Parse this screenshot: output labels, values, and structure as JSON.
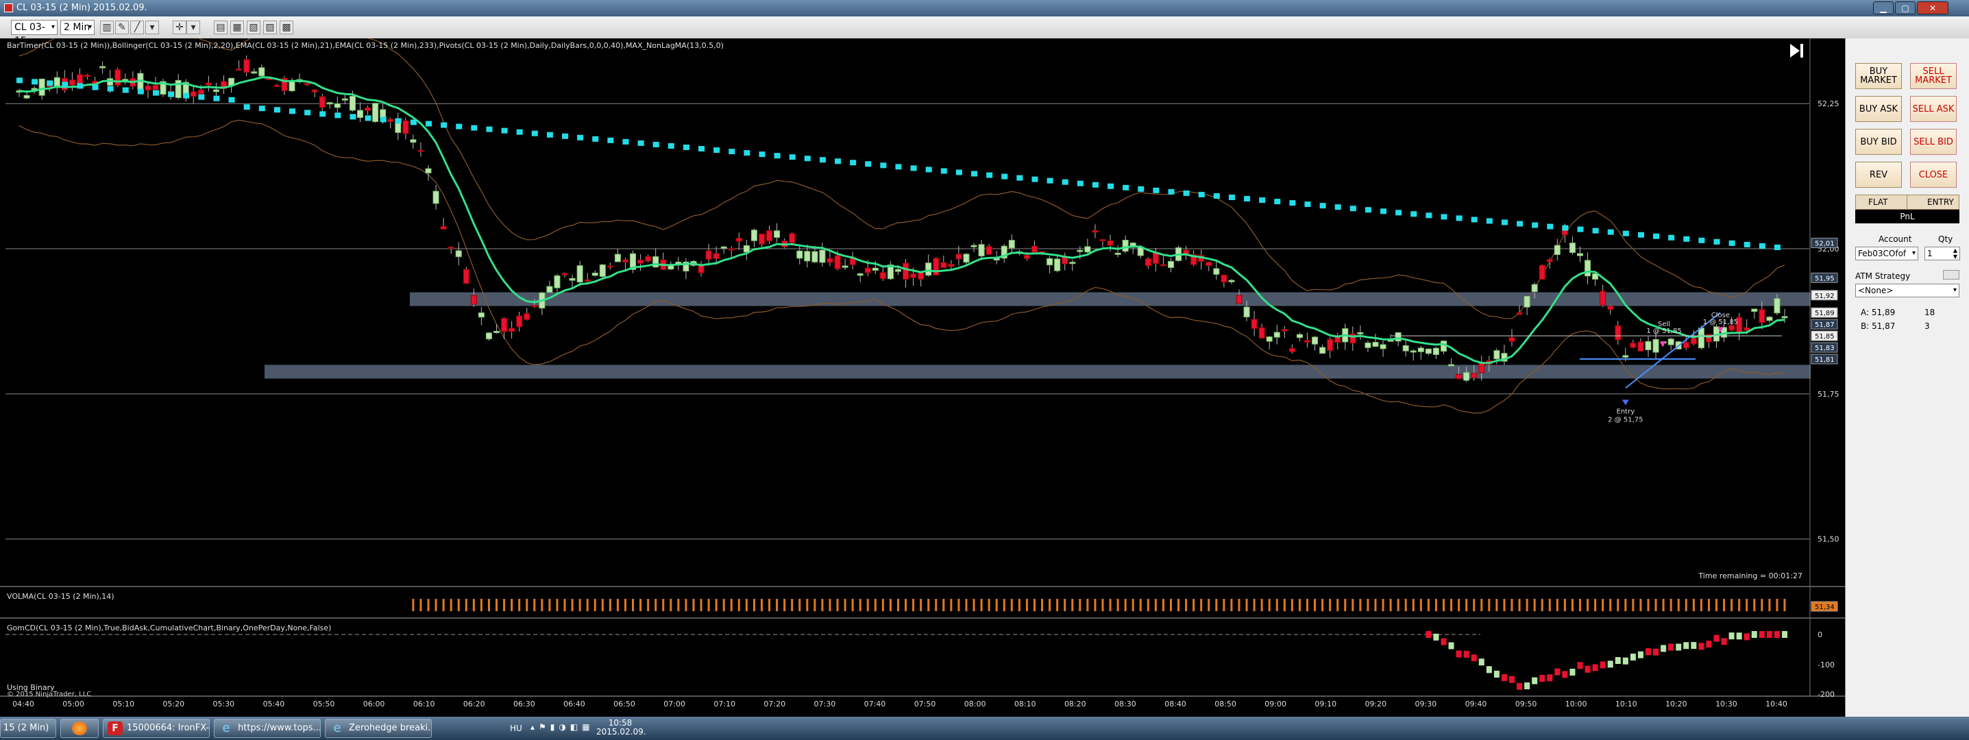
{
  "window": {
    "title": "CL 03-15 (2 Min)  2015.02.09."
  },
  "toolbar": {
    "instrument": "CL 03-15",
    "interval": "2 Min"
  },
  "chart": {
    "indicators_line": "BarTimer(CL 03-15 (2 Min)),Bollinger(CL 03-15 (2 Min),2,20),EMA(CL 03-15 (2 Min),21),EMA(CL 03-15 (2 Min),233),Pivots(CL 03-15 (2 Min),Daily,DailyBars,0,0,0,40),MAX_NonLagMA(13,0.5,0)",
    "time_remaining": "Time remaining = 00:01:27",
    "volume_label": "VOLMA(CL 03-15 (2 Min),14)",
    "gomcd_label": "GomCD(CL 03-15 (2 Min),True,BidAsk,CumulativeChart,Binary,OnePerDay,None,False)",
    "using_binary": "Using Binary",
    "copyright": "© 2015 NinjaTrader, LLC",
    "price_axis": [
      "52,25",
      "52,00",
      "51,75",
      "51,50"
    ],
    "price_badges": [
      "52,01",
      "51,95",
      "51,92",
      "51,89",
      "51,87",
      "51,85",
      "51,83",
      "51,81"
    ],
    "volume_badge": "51,34",
    "gomcd_axis": [
      "0",
      "-100",
      "-200"
    ],
    "time_axis": [
      "04:40",
      "05:00",
      "05:10",
      "05:20",
      "05:30",
      "05:40",
      "05:50",
      "06:00",
      "06:10",
      "06:20",
      "06:30",
      "06:40",
      "06:50",
      "07:00",
      "07:10",
      "07:20",
      "07:30",
      "07:40",
      "07:50",
      "08:00",
      "08:10",
      "08:20",
      "08:30",
      "08:40",
      "08:50",
      "09:00",
      "09:10",
      "09:20",
      "09:30",
      "09:40",
      "09:50",
      "10:00",
      "10:10",
      "10:20",
      "10:30",
      "10:40"
    ],
    "trades": {
      "sell_label": "Sell",
      "sell_detail": "1 @ 51,85",
      "close_label": "Close",
      "close_detail": "1 @ 51,85",
      "entry_label": "Entry",
      "entry_detail": "2 @ 51,75"
    }
  },
  "chart_data": {
    "type": "candlestick",
    "title": "CL 03-15 (2 Min)",
    "ylim": [
      51.43,
      52.36
    ],
    "price_gridlines": [
      52.25,
      52.0,
      51.75,
      51.5
    ],
    "support_resistance_bands": [
      [
        51.92,
        51.91
      ],
      [
        51.8,
        51.79
      ]
    ],
    "volume_profile": "uniform"
  },
  "panel": {
    "buttons": [
      {
        "label": "BUY\nMARKET",
        "red": false
      },
      {
        "label": "SELL\nMARKET",
        "red": true
      },
      {
        "label": "BUY ASK",
        "red": false
      },
      {
        "label": "SELL ASK",
        "red": true
      },
      {
        "label": "BUY BID",
        "red": false
      },
      {
        "label": "SELL BID",
        "red": true
      },
      {
        "label": "REV",
        "red": false
      },
      {
        "label": "CLOSE",
        "red": true
      }
    ],
    "flat": "FLAT",
    "entry": "ENTRY",
    "pnl": "PnL",
    "account_label": "Account",
    "qty_label": "Qty",
    "account_value": "Feb03COfof",
    "qty_value": "1",
    "atm_label": "ATM Strategy",
    "atm_value": "<None>",
    "ask_label": "A: 51,89",
    "ask_size": "18",
    "bid_label": "B: 51,87",
    "bid_size": "3"
  },
  "taskbar": {
    "tasks": [
      {
        "label": "15 (2 Min)"
      },
      {
        "label": ""
      },
      {
        "label": "15000664: IronFX-..."
      },
      {
        "label": "https://www.tops..."
      },
      {
        "label": "Zerohedge breaki..."
      }
    ],
    "lang": "HU",
    "time": "10:58",
    "date": "2015.02.09."
  },
  "colors": {
    "bull": "#b8e6a8",
    "bear": "#e8112d",
    "ema21": "#33e08a",
    "ema233": "#22dde8",
    "band": "#8aa0c0"
  }
}
